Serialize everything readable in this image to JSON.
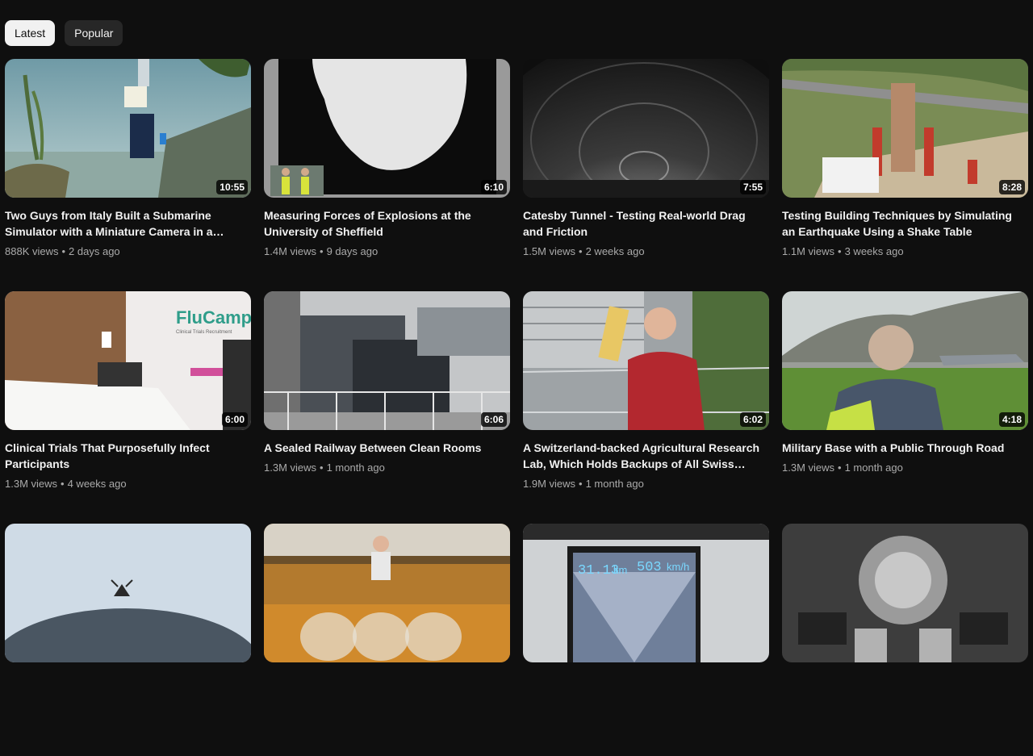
{
  "filters": [
    {
      "label": "Latest",
      "active": true
    },
    {
      "label": "Popular",
      "active": false
    }
  ],
  "videos": [
    {
      "title": "Two Guys from Italy Built a Submarine Simulator with a Miniature Camera in a Pond",
      "duration": "10:55",
      "views": "888K views",
      "age": "2 days ago"
    },
    {
      "title": "Measuring Forces of Explosions at the University of Sheffield",
      "duration": "6:10",
      "views": "1.4M views",
      "age": "9 days ago"
    },
    {
      "title": "Catesby Tunnel - Testing Real-world Drag and Friction",
      "duration": "7:55",
      "views": "1.5M views",
      "age": "2 weeks ago"
    },
    {
      "title": "Testing Building Techniques by Simulating an Earthquake Using a Shake Table",
      "duration": "8:28",
      "views": "1.1M views",
      "age": "3 weeks ago"
    },
    {
      "title": "Clinical Trials That Purposefully Infect Participants",
      "duration": "6:00",
      "views": "1.3M views",
      "age": "4 weeks ago"
    },
    {
      "title": "A Sealed Railway Between Clean Rooms",
      "duration": "6:06",
      "views": "1.3M views",
      "age": "1 month ago"
    },
    {
      "title": "A Switzerland-backed Agricultural Research Lab, Which Holds Backups of All Swiss Crops",
      "duration": "6:02",
      "views": "1.9M views",
      "age": "1 month ago"
    },
    {
      "title": "Military Base with a Public Through Road",
      "duration": "4:18",
      "views": "1.3M views",
      "age": "1 month ago"
    },
    {
      "title": "",
      "duration": "",
      "views": "",
      "age": ""
    },
    {
      "title": "",
      "duration": "",
      "views": "",
      "age": ""
    },
    {
      "title": "",
      "duration": "",
      "views": "",
      "age": ""
    },
    {
      "title": "",
      "duration": "",
      "views": "",
      "age": ""
    }
  ],
  "thumb_text": {
    "flucamp_logo": "FluCamp",
    "flucamp_tagline": "Clinical Trials Recruitment",
    "train_speed_km": "31.13",
    "train_speed_unit1": "km",
    "train_speed_kmh": "503",
    "train_speed_unit2": "km/h"
  }
}
